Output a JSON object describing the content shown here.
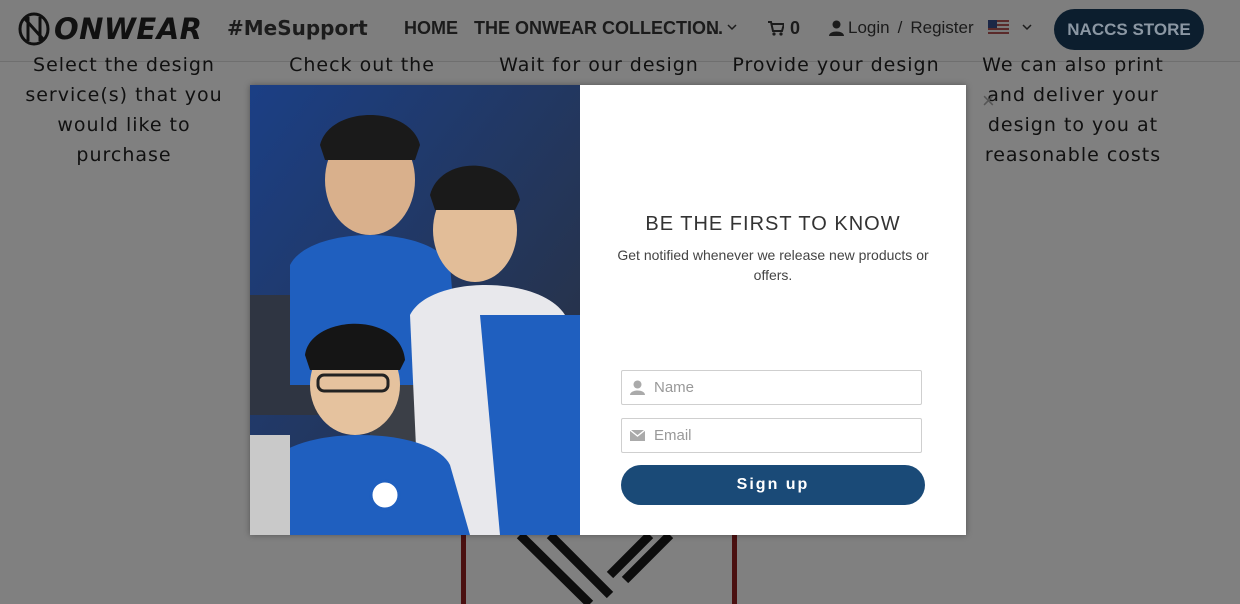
{
  "header": {
    "logo_text": "ONWEAR",
    "hashtag": "#MeSupport",
    "nav": {
      "home": "HOME",
      "collection": "THE ONWEAR COLLECTION",
      "more": "..."
    },
    "cart_count": "0",
    "login": "Login",
    "separator": "/",
    "register": "Register",
    "store_button": "NACCS STORE"
  },
  "background_steps": [
    "Select the design service(s) that you would like to purchase",
    "Check out the service",
    "Wait for our design team",
    "Provide your design",
    "We can also print and deliver your design to you at reasonable costs"
  ],
  "modal": {
    "close": "×",
    "title": "BE THE FIRST TO KNOW",
    "subtitle": "Get notified whenever we release new products or offers.",
    "name_placeholder": "Name",
    "email_placeholder": "Email",
    "signup_label": "Sign up"
  },
  "colors": {
    "overlay_bg": "#808080",
    "store_button_bg": "#0c1e2e",
    "signup_bg": "#1a4a77",
    "jacket_blue": "#1f5fbf"
  }
}
